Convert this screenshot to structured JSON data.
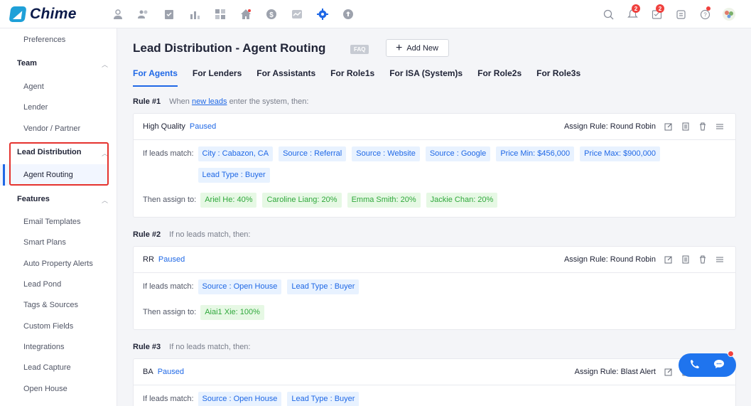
{
  "brand": {
    "name": "Chime"
  },
  "topnav": {
    "icons": [
      "contacts-icon",
      "team-icon",
      "tasks-icon",
      "analytics-icon",
      "dashboard-icon",
      "listings-icon",
      "billing-icon",
      "reports-icon",
      "settings-icon",
      "upload-icon"
    ],
    "notifications_count": "2",
    "tasks_count": "2"
  },
  "sidebar": {
    "preferences": "Preferences",
    "team": {
      "label": "Team",
      "items": [
        "Agent",
        "Lender",
        "Vendor / Partner"
      ]
    },
    "lead_distribution": {
      "label": "Lead Distribution",
      "items": [
        "Agent Routing"
      ]
    },
    "features": {
      "label": "Features",
      "items": [
        "Email Templates",
        "Smart Plans",
        "Auto Property Alerts",
        "Lead Pond",
        "Tags & Sources",
        "Custom Fields",
        "Integrations",
        "Lead Capture",
        "Open House"
      ]
    }
  },
  "page": {
    "title": "Lead Distribution - Agent Routing",
    "faq": "FAQ",
    "add_new": "Add New",
    "tabs": [
      "For Agents",
      "For Lenders",
      "For Assistants",
      "For Role1s",
      "For ISA (System)s",
      "For Role2s",
      "For Role3s"
    ],
    "active_tab": 0
  },
  "labels": {
    "if_leads_match": "If leads match:",
    "then_assign_to": "Then assign to:"
  },
  "rules": [
    {
      "number": "Rule #1",
      "condition_prefix": "When",
      "condition_link": "new leads",
      "condition_suffix": "enter the system, then:",
      "name": "High Quality",
      "status": "Paused",
      "assign_rule": "Assign Rule: Round Robin",
      "match": [
        "City : Cabazon, CA",
        "Source : Referral",
        "Source : Website",
        "Source : Google",
        "Price Min: $456,000",
        "Price Max: $900,000",
        "Lead Type : Buyer"
      ],
      "assign": [
        "Ariel He: 40%",
        "Caroline Liang: 20%",
        "Emma Smith: 20%",
        "Jackie Chan: 20%"
      ]
    },
    {
      "number": "Rule #2",
      "condition": "If no leads match, then:",
      "name": "RR",
      "status": "Paused",
      "assign_rule": "Assign Rule: Round Robin",
      "match": [
        "Source : Open House",
        "Lead Type : Buyer"
      ],
      "assign": [
        "Aiai1 Xie: 100%"
      ]
    },
    {
      "number": "Rule #3",
      "condition": "If no leads match, then:",
      "name": "BA",
      "status": "Paused",
      "assign_rule": "Assign Rule: Blast Alert",
      "match": [
        "Source : Open House",
        "Lead Type : Buyer"
      ],
      "assign": []
    }
  ],
  "colors": {
    "accent": "#1f68e6",
    "highlight_box": "#e5322e",
    "assign_chip": "#2fa83b"
  }
}
